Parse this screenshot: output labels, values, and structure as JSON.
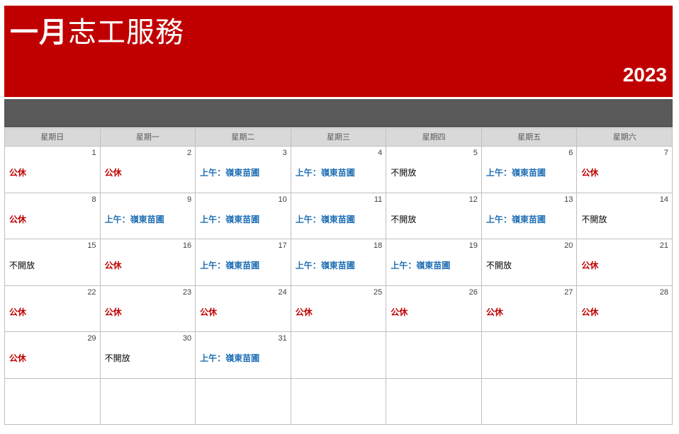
{
  "header": {
    "month": "一月",
    "title_rest": "志工服務",
    "year": "2023"
  },
  "colors": {
    "header_bg": "#c00000",
    "band_bg": "#595959",
    "holiday_text": "#c00000",
    "service_text": "#1f6fb4",
    "weekday_bg": "#d9d9d9"
  },
  "weekdays": [
    "星期日",
    "星期一",
    "星期二",
    "星期三",
    "星期四",
    "星期五",
    "星期六"
  ],
  "weeks": [
    [
      {
        "day": "1",
        "note": "公休",
        "kind": "holiday"
      },
      {
        "day": "2",
        "note": "公休",
        "kind": "holiday"
      },
      {
        "day": "3",
        "note": "上午：嶺東苗圃",
        "kind": "service"
      },
      {
        "day": "4",
        "note": "上午：嶺東苗圃",
        "kind": "service"
      },
      {
        "day": "5",
        "note": "不開放",
        "kind": "closed"
      },
      {
        "day": "6",
        "note": "上午：嶺東苗圃",
        "kind": "service"
      },
      {
        "day": "7",
        "note": "公休",
        "kind": "holiday"
      }
    ],
    [
      {
        "day": "8",
        "note": "公休",
        "kind": "holiday"
      },
      {
        "day": "9",
        "note": "上午：嶺東苗圃",
        "kind": "service"
      },
      {
        "day": "10",
        "note": "上午：嶺東苗圃",
        "kind": "service"
      },
      {
        "day": "11",
        "note": "上午：嶺東苗圃",
        "kind": "service"
      },
      {
        "day": "12",
        "note": "不開放",
        "kind": "closed"
      },
      {
        "day": "13",
        "note": "上午：嶺東苗圃",
        "kind": "service"
      },
      {
        "day": "14",
        "note": "不開放",
        "kind": "closed"
      }
    ],
    [
      {
        "day": "15",
        "note": "不開放",
        "kind": "closed"
      },
      {
        "day": "16",
        "note": "公休",
        "kind": "holiday"
      },
      {
        "day": "17",
        "note": "上午：嶺東苗圃",
        "kind": "service"
      },
      {
        "day": "18",
        "note": "上午：嶺東苗圃",
        "kind": "service"
      },
      {
        "day": "19",
        "note": "上午：嶺東苗圃",
        "kind": "service"
      },
      {
        "day": "20",
        "note": "不開放",
        "kind": "closed"
      },
      {
        "day": "21",
        "note": "公休",
        "kind": "holiday"
      }
    ],
    [
      {
        "day": "22",
        "note": "公休",
        "kind": "holiday"
      },
      {
        "day": "23",
        "note": "公休",
        "kind": "holiday"
      },
      {
        "day": "24",
        "note": "公休",
        "kind": "holiday"
      },
      {
        "day": "25",
        "note": "公休",
        "kind": "holiday"
      },
      {
        "day": "26",
        "note": "公休",
        "kind": "holiday"
      },
      {
        "day": "27",
        "note": "公休",
        "kind": "holiday"
      },
      {
        "day": "28",
        "note": "公休",
        "kind": "holiday"
      }
    ],
    [
      {
        "day": "29",
        "note": "公休",
        "kind": "holiday"
      },
      {
        "day": "30",
        "note": "不開放",
        "kind": "closed"
      },
      {
        "day": "31",
        "note": "上午：嶺東苗圃",
        "kind": "service"
      },
      {
        "day": "",
        "note": "",
        "kind": "empty"
      },
      {
        "day": "",
        "note": "",
        "kind": "empty"
      },
      {
        "day": "",
        "note": "",
        "kind": "empty"
      },
      {
        "day": "",
        "note": "",
        "kind": "empty"
      }
    ],
    [
      {
        "day": "",
        "note": "",
        "kind": "empty"
      },
      {
        "day": "",
        "note": "",
        "kind": "empty"
      },
      {
        "day": "",
        "note": "",
        "kind": "empty"
      },
      {
        "day": "",
        "note": "",
        "kind": "empty"
      },
      {
        "day": "",
        "note": "",
        "kind": "empty"
      },
      {
        "day": "",
        "note": "",
        "kind": "empty"
      },
      {
        "day": "",
        "note": "",
        "kind": "empty"
      }
    ]
  ]
}
